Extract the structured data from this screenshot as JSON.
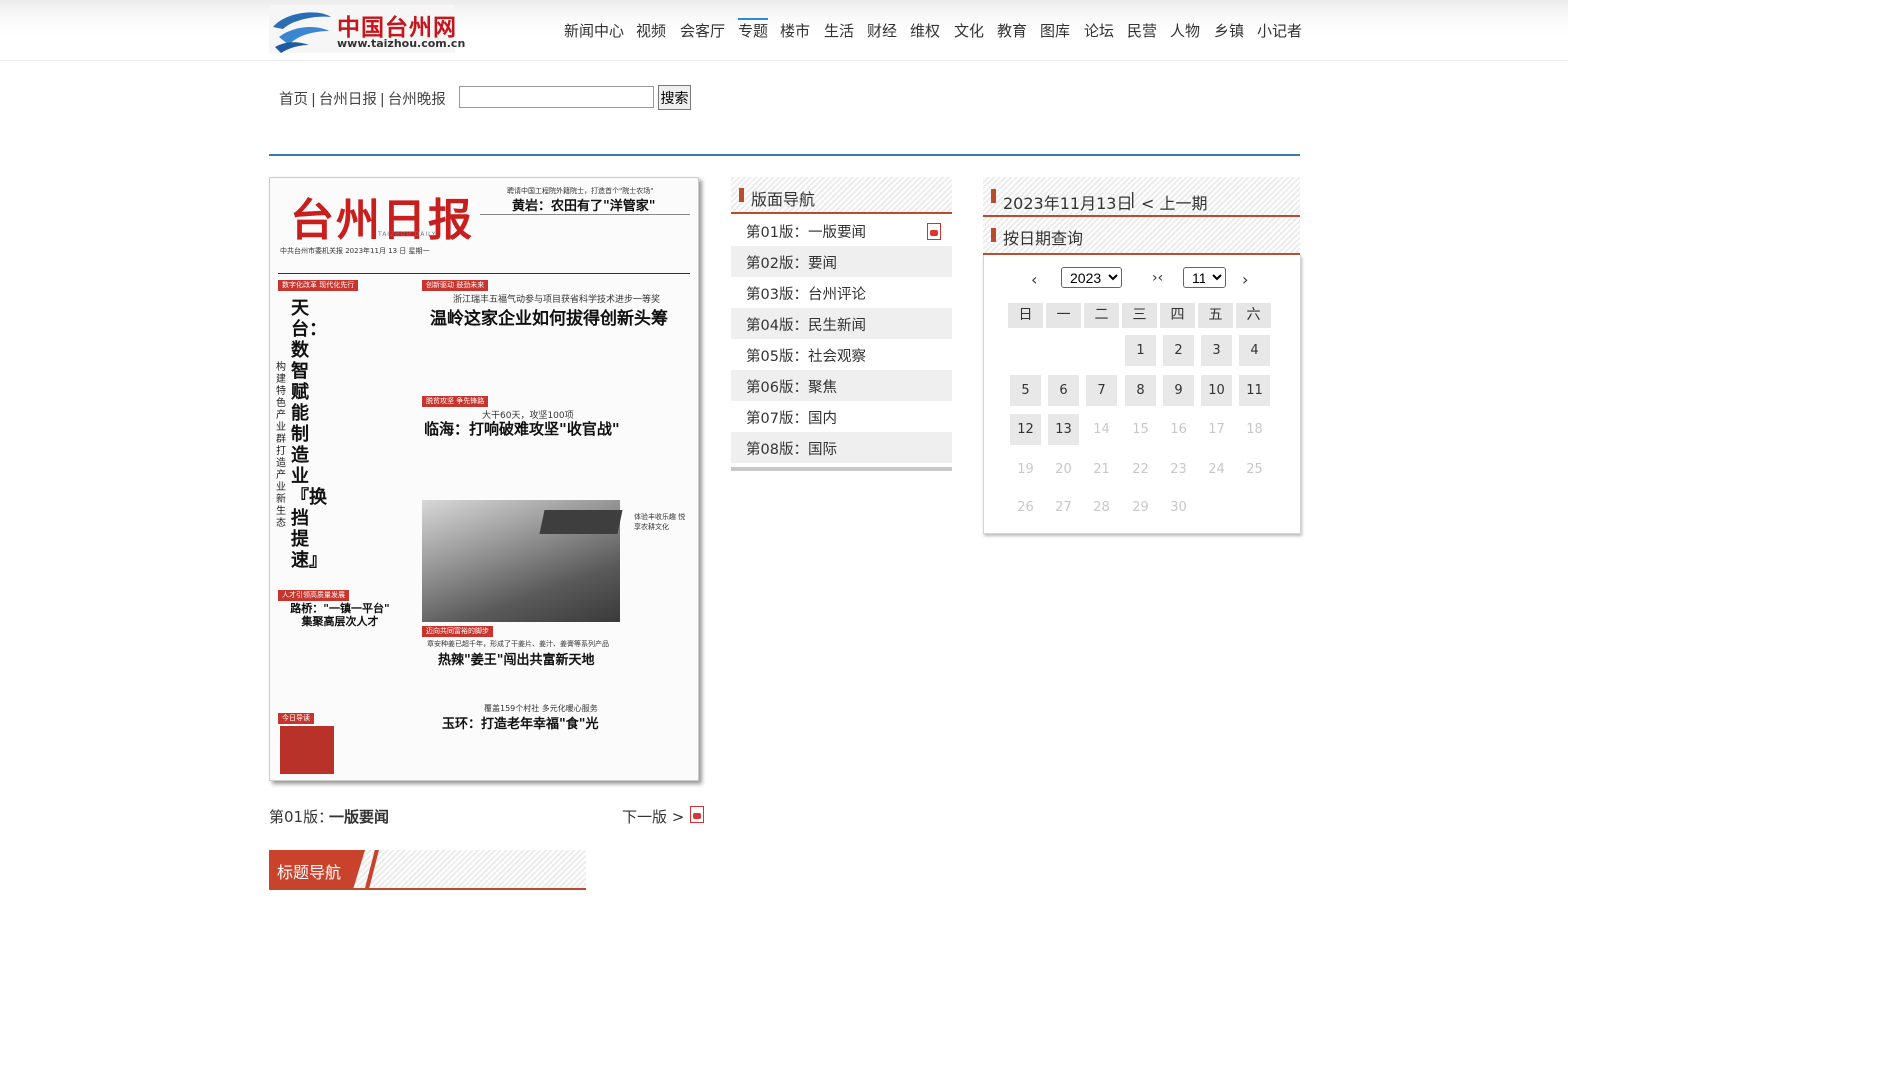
{
  "site": {
    "logo_text": "中国台州网",
    "logo_url_text": "www.taizhou.com.cn",
    "nav": [
      "新闻中心",
      "视频",
      "会客厅",
      "专题",
      "楼市",
      "生活",
      "财经",
      "维权",
      "文化",
      "教育",
      "图库",
      "论坛",
      "民营",
      "人物",
      "乡镇",
      "小记者"
    ]
  },
  "breadcrumb": {
    "home": "首页",
    "daily": "台州日报",
    "evening": "台州晚报",
    "sep": "|"
  },
  "search": {
    "placeholder": "",
    "value": "",
    "button": "搜索"
  },
  "paper": {
    "masthead": "台州日报",
    "sub": "TAIZHOU DAILY",
    "meta": "中共台州市委机关报    2023年11月 13 日    星期一",
    "top_kicker": "聘请中国工程院外籍院士，打造首个\"院士农场\"",
    "top_headline": "黄岩：农田有了\"洋管家\"",
    "tag1": "数字化改革 现代化先行",
    "tag2": "创新驱动 鼓劲未来",
    "wenling_kicker": "浙江瑞丰五福气动参与项目获省科学技术进步一等奖",
    "wenling_headline": "温岭这家企业如何拔得创新头筹",
    "vertical_headline": "天台：数智赋能制造业『换挡提速』",
    "vertical_sub": "构建特色产业群 打造产业新生态",
    "tag3": "脱贫攻坚 争先锋路",
    "linhai_kicker": "大干60天，攻坚100项",
    "linhai_headline": "临海：打响破难攻坚\"收官战\"",
    "photo_caption": "体验丰收乐趣 悦享农耕文化",
    "tag4": "人才引领高质量发展",
    "luqiao_headline": "路桥：\"一镇一平台\" 集聚高层次人才",
    "tag5": "迈向共同富裕的脚步",
    "ginger_kicker": "章安种姜已超千年，形成了干姜片、姜汁、姜膏等系列产品",
    "ginger_headline": "热辣\"姜王\"闯出共富新天地",
    "yuhuan_kicker": "覆盖159个村社 多元化暖心服务",
    "yuhuan_headline": "玉环：打造老年幸福\"食\"光",
    "tag6": "今日导读"
  },
  "layout_nav": {
    "title": "版面导航",
    "items": [
      {
        "label": "第01版：一版要闻",
        "pdf": true
      },
      {
        "label": "第02版：要闻"
      },
      {
        "label": "第03版：台州评论"
      },
      {
        "label": "第04版：民生新闻"
      },
      {
        "label": "第05版：社会观察"
      },
      {
        "label": "第06版：聚焦"
      },
      {
        "label": "第07版：国内"
      },
      {
        "label": "第08版：国际"
      }
    ]
  },
  "date_panel": {
    "date": "2023年11月13日",
    "sep": "|",
    "prev_issue": "< 上一期",
    "query_title": "按日期查询"
  },
  "calendar": {
    "year": "2023",
    "month": "11",
    "prev": "‹",
    "today": "›‹",
    "next": "›",
    "weekdays": [
      "日",
      "一",
      "二",
      "三",
      "四",
      "五",
      "六"
    ],
    "days_active": [
      "1",
      "2",
      "3",
      "4",
      "5",
      "6",
      "7",
      "8",
      "9",
      "10",
      "11",
      "12",
      "13"
    ],
    "days_inactive": [
      "14",
      "15",
      "16",
      "17",
      "18",
      "19",
      "20",
      "21",
      "22",
      "23",
      "24",
      "25",
      "26",
      "27",
      "28",
      "29",
      "30"
    ]
  },
  "bottom": {
    "page_label": "第01版：",
    "page_name": "一版要闻",
    "next_label": "下一版 >"
  },
  "title_nav": {
    "title": "标题导航"
  }
}
